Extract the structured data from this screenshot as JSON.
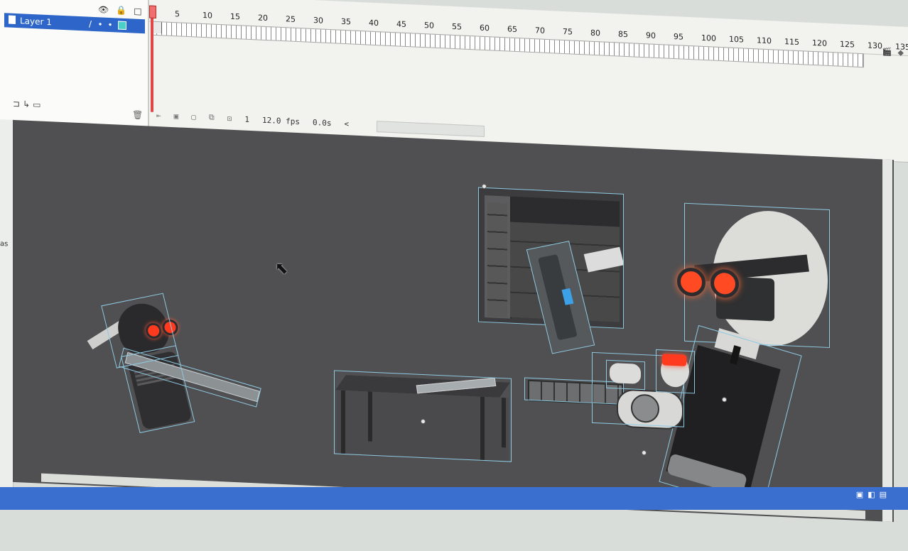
{
  "timeline": {
    "layer_name": "Layer 1",
    "ruler_ticks": [
      "5",
      "10",
      "15",
      "20",
      "25",
      "30",
      "35",
      "40",
      "45",
      "50",
      "55",
      "60",
      "65",
      "70",
      "75",
      "80",
      "85",
      "90",
      "95",
      "100",
      "105",
      "110",
      "115",
      "120",
      "125",
      "130",
      "135"
    ],
    "current_frame": "1",
    "frame_rate": "12.0 fps",
    "elapsed_time": "0.0s",
    "scroll_arrow": "<"
  },
  "left_strip": {
    "label": "as"
  },
  "colors": {
    "stage_bg": "#505052",
    "selection": "#8ec9e0",
    "layer_highlight": "#2d66c8",
    "goggle_glow": "#ff4a24",
    "playhead": "#e04646"
  },
  "icons": [
    "eye-icon",
    "lock-icon",
    "outline-icon",
    "pencil-icon",
    "trash-icon",
    "new-layer-icon",
    "cursor-icon",
    "onion-skin-icon"
  ]
}
